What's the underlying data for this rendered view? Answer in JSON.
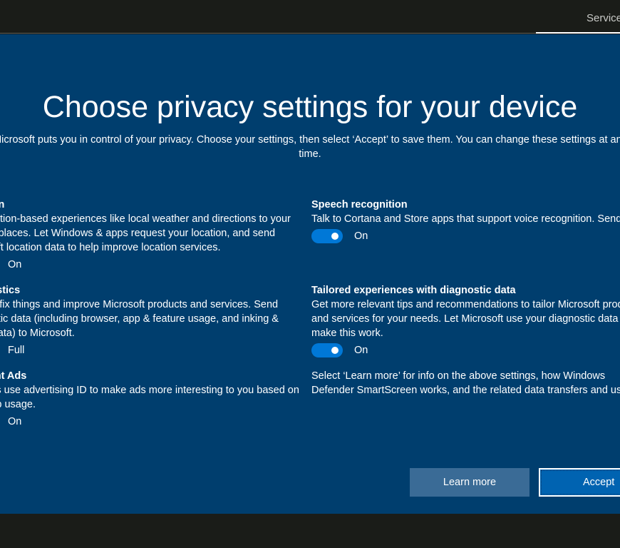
{
  "header": {
    "tab_label": "Services"
  },
  "page": {
    "title": "Choose privacy settings for your device",
    "subtitle_line1": "Microsoft puts you in control of your privacy. Choose your settings, then select ‘Accept’ to save them. You can change these settings at any",
    "subtitle_line2": "time."
  },
  "left_settings": [
    {
      "title": "Location",
      "desc": "Get location-based experiences like local weather and directions to your favorite places. Let Windows & apps request your location, and send Microsoft location data to help improve location services.",
      "value": "On"
    },
    {
      "title": "Diagnostics",
      "desc": "Help us fix things and improve Microsoft products and services. Send diagnostic data (including browser, app & feature usage, and inking & typing data) to Microsoft.",
      "value": "Full"
    },
    {
      "title": "Relevant Ads",
      "desc": "Let apps use advertising ID to make ads more interesting to you based on your app usage.",
      "value": "On"
    }
  ],
  "right_settings": [
    {
      "title": "Speech recognition",
      "desc": "Talk to Cortana and Store apps that support voice recognition. Send Microsoft your voice input to help improve speech services.",
      "value": "On"
    },
    {
      "title": "Tailored experiences with diagnostic data",
      "desc": "Get more relevant tips and recommendations to tailor Microsoft products and services for your needs. Let Microsoft use your diagnostic data to make this work.",
      "value": "On"
    }
  ],
  "info": {
    "line1": "Select ‘Learn more’ for info on the above settings, how Windows",
    "line2": "Defender SmartScreen works, and the related data transfers and uses."
  },
  "buttons": {
    "learn_more": "Learn more",
    "accept": "Accept"
  },
  "colors": {
    "panel_bg": "#003e6e",
    "toggle_on": "#0078d7",
    "accept_bg": "#0063b1",
    "learn_bg": "#3a6b96"
  }
}
